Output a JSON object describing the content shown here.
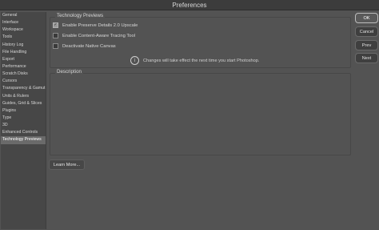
{
  "window": {
    "title": "Preferences"
  },
  "sidebar": {
    "items": [
      "General",
      "Interface",
      "Workspace",
      "Tools",
      "History Log",
      "File Handling",
      "Export",
      "Performance",
      "Scratch Disks",
      "Cursors",
      "Transparency & Gamut",
      "Units & Rulers",
      "Guides, Grid & Slices",
      "Plugins",
      "Type",
      "3D",
      "Enhanced Controls",
      "Technology Previews"
    ],
    "selected": "Technology Previews"
  },
  "tech_previews": {
    "title": "Technology Previews",
    "options": [
      {
        "label": "Enable Preserve Details 2.0 Upscale",
        "checked": true
      },
      {
        "label": "Enable Content-Aware Tracing Tool",
        "checked": false
      },
      {
        "label": "Deactivate Native Canvas",
        "checked": false
      }
    ],
    "info_text": "Changes will take effect the next time you start Photoshop."
  },
  "description": {
    "title": "Description"
  },
  "learn_more": "Learn More...",
  "buttons": {
    "ok": "OK",
    "cancel": "Cancel",
    "prev": "Prev",
    "next": "Next"
  },
  "icons": {
    "info": "info-icon",
    "check": "checkmark-icon"
  }
}
